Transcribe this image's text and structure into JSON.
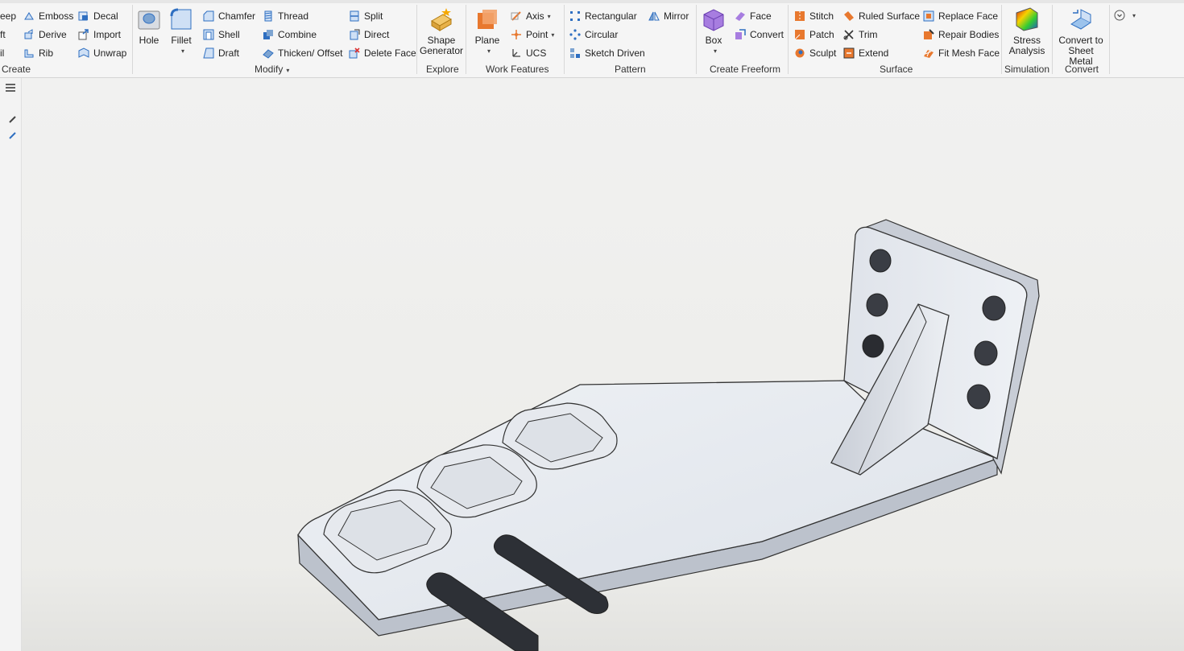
{
  "ribbon": {
    "create": {
      "group_label": "Create",
      "items": [
        "eep",
        "ft",
        "il",
        "Emboss",
        "Derive",
        "Rib",
        "Decal",
        "Import",
        "Unwrap"
      ]
    },
    "modify": {
      "group_label": "Modify",
      "hole": "Hole",
      "fillet": "Fillet",
      "items": [
        "Chamfer",
        "Shell",
        "Draft",
        "Thread",
        "Combine",
        "Thicken/ Offset",
        "Split",
        "Direct",
        "Delete Face"
      ]
    },
    "explore": {
      "group_label": "Explore",
      "shape_generator": [
        "Shape",
        "Generator"
      ]
    },
    "work_features": {
      "group_label": "Work Features",
      "plane": "Plane",
      "axis": "Axis",
      "point": "Point",
      "ucs": "UCS"
    },
    "pattern": {
      "group_label": "Pattern",
      "items": [
        "Rectangular",
        "Circular",
        "Sketch Driven",
        "Mirror"
      ]
    },
    "create_freeform": {
      "group_label": "Create Freeform",
      "box": "Box",
      "face": "Face",
      "convert": "Convert"
    },
    "surface": {
      "group_label": "Surface",
      "items": [
        "Stitch",
        "Patch",
        "Sculpt",
        "Ruled Surface",
        "Trim",
        "Extend",
        "Replace Face",
        "Repair Bodies",
        "Fit Mesh Face"
      ]
    },
    "simulation": {
      "group_label": "Simulation",
      "stress_analysis": [
        "Stress",
        "Analysis"
      ]
    },
    "convert": {
      "group_label": "Convert",
      "to_sheet_metal": [
        "Convert to",
        "Sheet Metal"
      ]
    }
  },
  "colors": {
    "ribbon_bg": "#f5f5f5",
    "viewport_bg": "#efefed",
    "model_fill": "#e4e8ee",
    "accent_blue": "#2f6fc1",
    "accent_orange": "#e8782e"
  }
}
